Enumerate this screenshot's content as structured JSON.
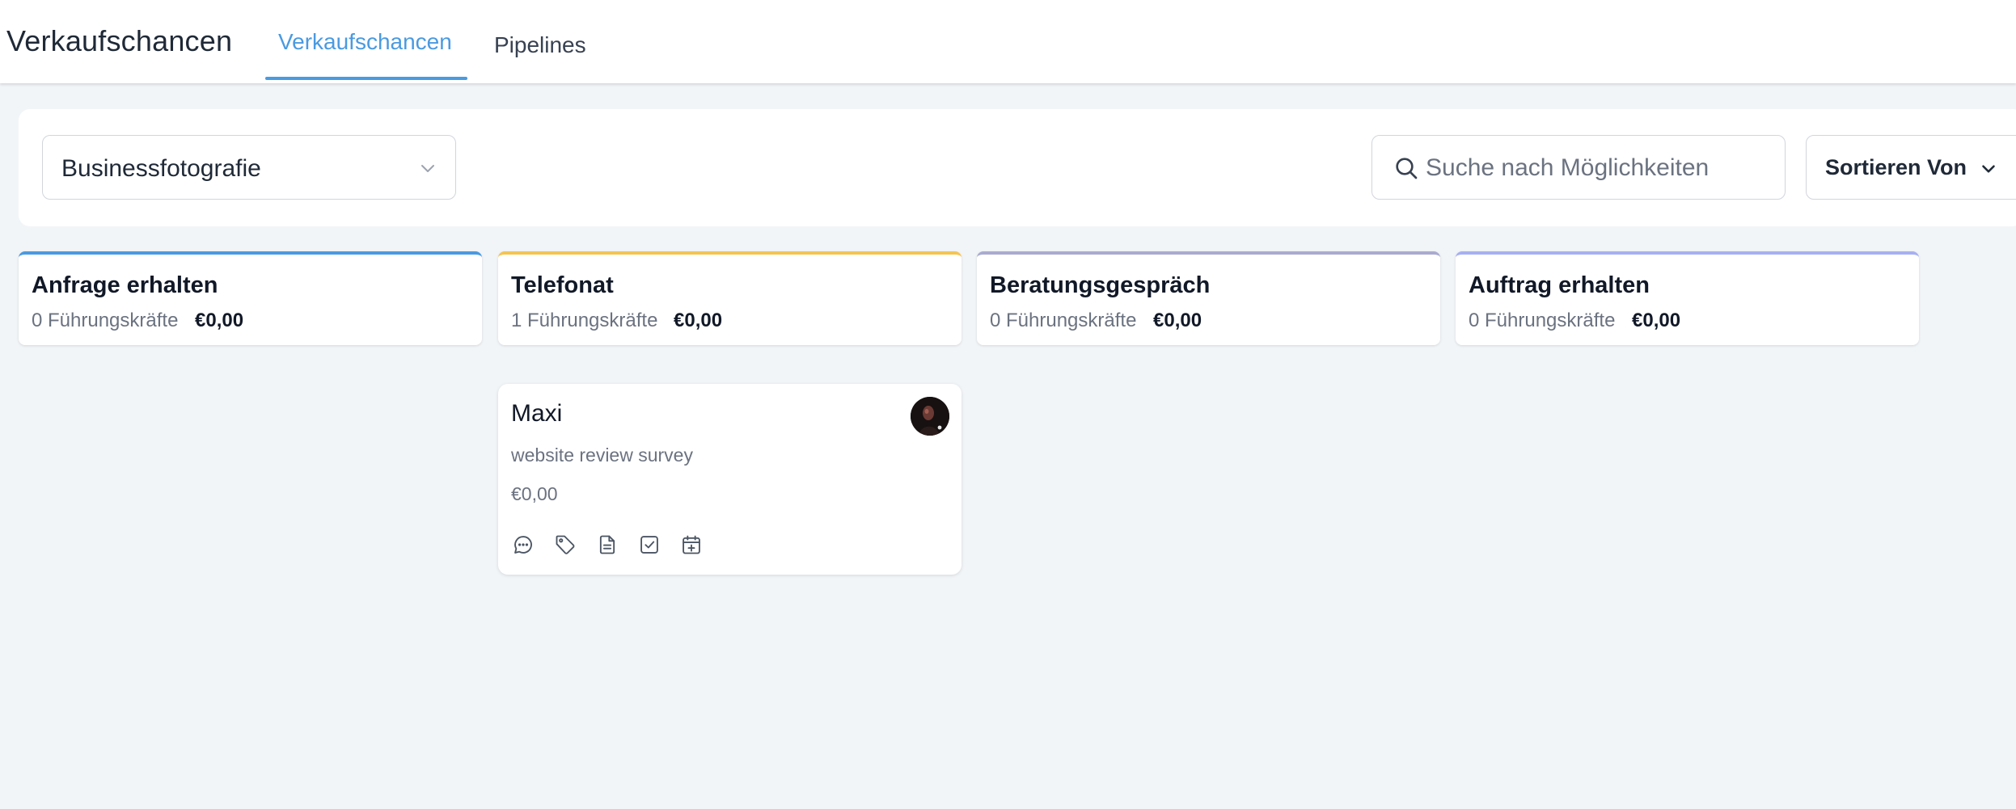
{
  "header": {
    "title": "Verkaufschancen",
    "tabs": [
      {
        "label": "Verkaufschancen",
        "active": true
      },
      {
        "label": "Pipelines",
        "active": false
      }
    ]
  },
  "filters": {
    "pipeline_selected": "Businessfotografie",
    "search_placeholder": "Suche nach Möglichkeiten",
    "sort_label": "Sortieren Von"
  },
  "stages": [
    {
      "name": "Anfrage erhalten",
      "count": "0 Führungskräfte",
      "amount": "€0,00",
      "color": "#4a9ae0"
    },
    {
      "name": "Telefonat",
      "count": "1 Führungskräfte",
      "amount": "€0,00",
      "color": "#f5c451"
    },
    {
      "name": "Beratungsgespräch",
      "count": "0 Führungskräfte",
      "amount": "€0,00",
      "color": "#a9abcf"
    },
    {
      "name": "Auftrag erhalten",
      "count": "0 Führungskräfte",
      "amount": "€0,00",
      "color": "#a7b0f2"
    }
  ],
  "opportunity": {
    "name": "Maxi",
    "source": "website review survey",
    "value": "€0,00",
    "actions": [
      "chat-icon",
      "tag-icon",
      "document-icon",
      "task-checkbox-icon",
      "calendar-add-icon"
    ]
  },
  "colors": {
    "accent": "#4a9ae0",
    "background": "#f2f5f8"
  }
}
